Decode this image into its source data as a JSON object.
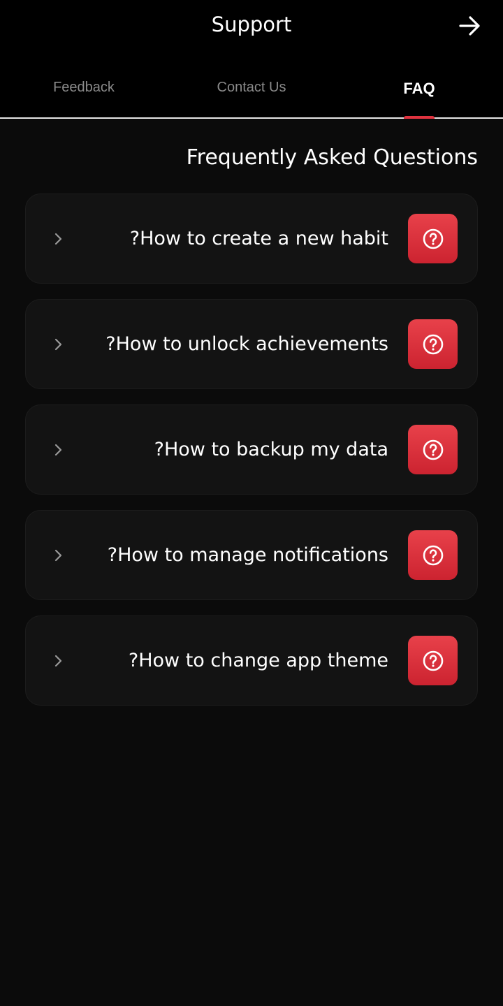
{
  "header": {
    "title": "Support",
    "back_icon": "arrow-right-icon"
  },
  "tabs": [
    {
      "label": "Feedback",
      "active": false
    },
    {
      "label": "Contact Us",
      "active": false
    },
    {
      "label": "FAQ",
      "active": true
    }
  ],
  "faq": {
    "title": "Frequently Asked Questions",
    "items": [
      {
        "question": "?How to create a new habit"
      },
      {
        "question": "?How to unlock achievements"
      },
      {
        "question": "?How to backup my data"
      },
      {
        "question": "?How to manage notifications"
      },
      {
        "question": "?How to change app theme"
      }
    ],
    "item_icon": "question-circle-icon",
    "expand_icon": "chevron-right-icon"
  },
  "colors": {
    "background": "#0b0b0b",
    "accent": "#e0333f",
    "card": "#131313",
    "inactive_tab": "#8a8a8a"
  }
}
